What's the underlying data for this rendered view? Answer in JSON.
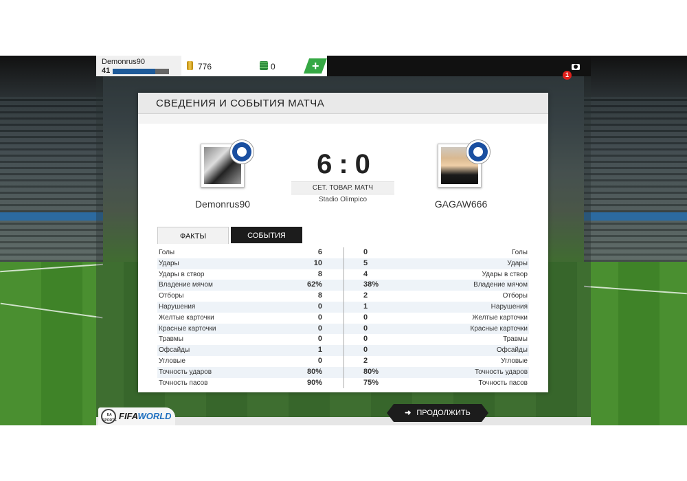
{
  "user": {
    "name": "Demonrus90",
    "level": "41",
    "xp_fraction": 0.76
  },
  "currency": {
    "coins": "776",
    "points": "0",
    "add_label": "+"
  },
  "notifications": {
    "count": "1"
  },
  "panel": {
    "title": "СВЕДЕНИЯ И СОБЫТИЯ МАТЧА"
  },
  "match": {
    "home_team": "Demonrus90",
    "away_team": "GAGAW666",
    "home_score": "6",
    "away_score": "0",
    "separator": ":",
    "type": "СЕТ. ТОВАР. МАТЧ",
    "stadium": "Stadio Olimpico"
  },
  "tabs": {
    "facts": "ФАКТЫ",
    "events": "СОБЫТИЯ"
  },
  "stats": [
    {
      "label": "Голы",
      "home": "6",
      "away": "0"
    },
    {
      "label": "Удары",
      "home": "10",
      "away": "5"
    },
    {
      "label": "Удары в створ",
      "home": "8",
      "away": "4"
    },
    {
      "label": "Владение мячом",
      "home": "62%",
      "away": "38%"
    },
    {
      "label": "Отборы",
      "home": "8",
      "away": "2"
    },
    {
      "label": "Нарушения",
      "home": "0",
      "away": "1"
    },
    {
      "label": "Желтые карточки",
      "home": "0",
      "away": "0"
    },
    {
      "label": "Красные карточки",
      "home": "0",
      "away": "0"
    },
    {
      "label": "Травмы",
      "home": "0",
      "away": "0"
    },
    {
      "label": "Офсайды",
      "home": "1",
      "away": "0"
    },
    {
      "label": "Угловые",
      "home": "0",
      "away": "2"
    },
    {
      "label": "Точность ударов",
      "home": "80%",
      "away": "80%"
    },
    {
      "label": "Точность пасов",
      "home": "90%",
      "away": "75%"
    }
  ],
  "footer": {
    "brand_ea": "EA SPORTS",
    "brand_fifa": "FIFA",
    "brand_world": "WORLD",
    "continue_label": "ПРОДОЛЖИТЬ"
  },
  "colors": {
    "accent_green": "#35a844",
    "xp_blue": "#1e5a99",
    "badge_red": "#e0201c",
    "brand_blue": "#1e6fbf"
  }
}
